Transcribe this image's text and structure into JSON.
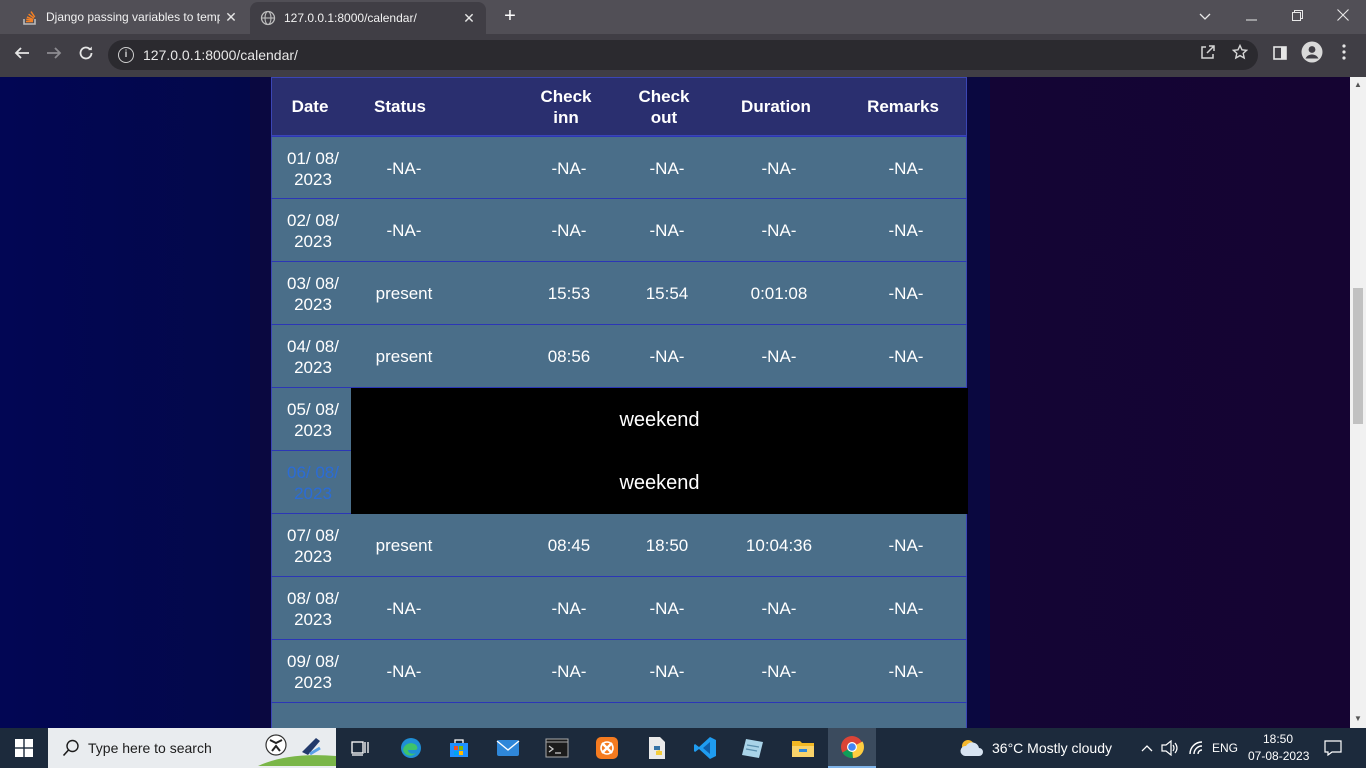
{
  "browser": {
    "tabs": [
      {
        "title": "Django passing variables to temp",
        "active": false
      },
      {
        "title": "127.0.0.1:8000/calendar/",
        "active": true
      }
    ],
    "url": "127.0.0.1:8000/calendar/",
    "new_tab_label": "+"
  },
  "table": {
    "headers": {
      "date": "Date",
      "status": "Status",
      "check_in_1": "Check",
      "check_in_2": "inn",
      "check_out_1": "Check",
      "check_out_2": "out",
      "duration": "Duration",
      "remarks": "Remarks"
    },
    "rows": [
      {
        "date_1": "01/ 08/",
        "date_2": "2023",
        "status": "-NA-",
        "check_in": "-NA-",
        "check_out": "-NA-",
        "duration": "-NA-",
        "remarks": "-NA-"
      },
      {
        "date_1": "02/ 08/",
        "date_2": "2023",
        "status": "-NA-",
        "check_in": "-NA-",
        "check_out": "-NA-",
        "duration": "-NA-",
        "remarks": "-NA-"
      },
      {
        "date_1": "03/ 08/",
        "date_2": "2023",
        "status": "present",
        "check_in": "15:53",
        "check_out": "15:54",
        "duration": "0:01:08",
        "remarks": "-NA-"
      },
      {
        "date_1": "04/ 08/",
        "date_2": "2023",
        "status": "present",
        "check_in": "08:56",
        "check_out": "-NA-",
        "duration": "-NA-",
        "remarks": "-NA-"
      },
      {
        "date_1": "05/ 08/",
        "date_2": "2023",
        "weekend": "weekend"
      },
      {
        "date_1": "06/ 08/",
        "date_2": "2023",
        "weekend": "weekend"
      },
      {
        "date_1": "07/ 08/",
        "date_2": "2023",
        "status": "present",
        "check_in": "08:45",
        "check_out": "18:50",
        "duration": "10:04:36",
        "remarks": "-NA-"
      },
      {
        "date_1": "08/ 08/",
        "date_2": "2023",
        "status": "-NA-",
        "check_in": "-NA-",
        "check_out": "-NA-",
        "duration": "-NA-",
        "remarks": "-NA-"
      },
      {
        "date_1": "09/ 08/",
        "date_2": "2023",
        "status": "-NA-",
        "check_in": "-NA-",
        "check_out": "-NA-",
        "duration": "-NA-",
        "remarks": "-NA-"
      }
    ]
  },
  "taskbar": {
    "search_placeholder": "Type here to search",
    "weather": "36°C  Mostly cloudy",
    "language": "ENG",
    "time": "18:50",
    "date": "07-08-2023"
  },
  "colors": {
    "row_bg": "#4a6e89",
    "header_bg": "#2a2f6f",
    "weekend_bg": "#000000",
    "today_date": "#2b6cd6"
  }
}
